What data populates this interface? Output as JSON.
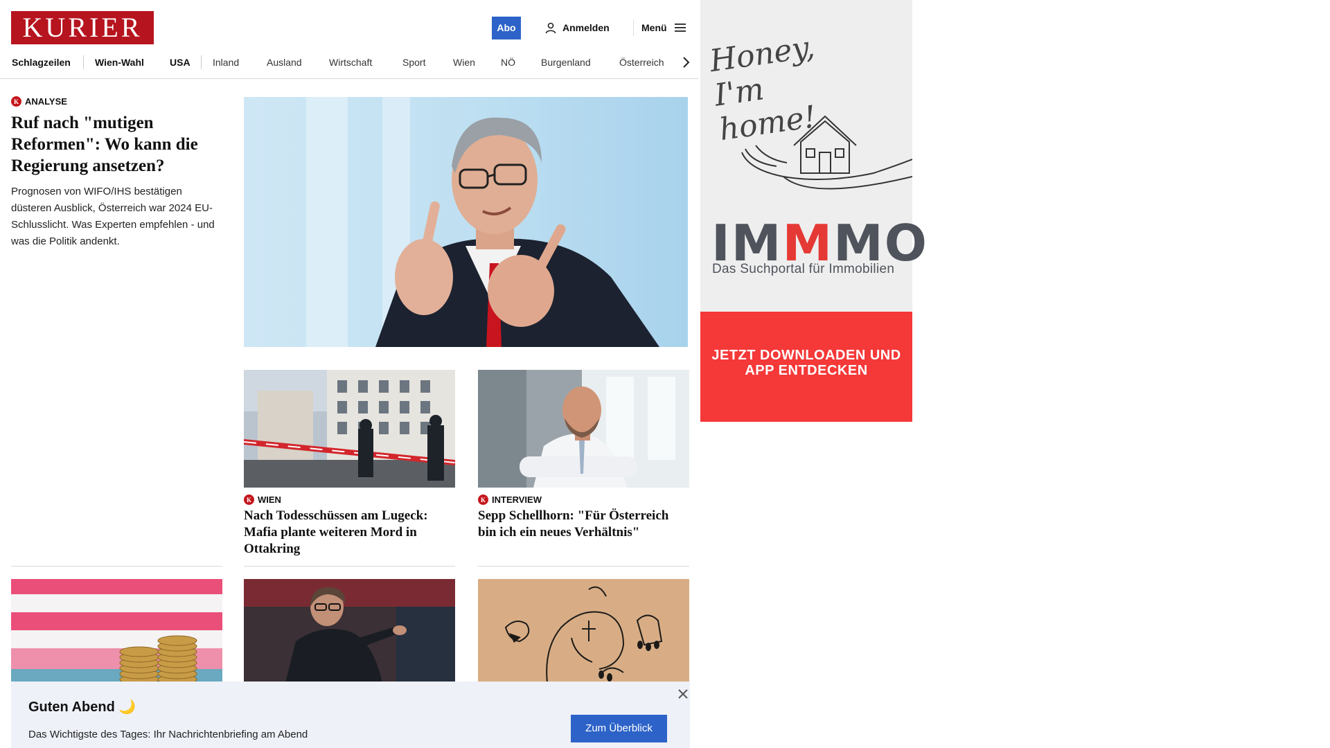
{
  "header": {
    "logo": "KURIER",
    "abo_label": "Abo",
    "login_label": "Anmelden",
    "menu_label": "Menü"
  },
  "nav": {
    "items": [
      "Schlagzeilen",
      "Wien-Wahl",
      "USA",
      "Inland",
      "Ausland",
      "Wirtschaft",
      "Sport",
      "Wien",
      "NÖ",
      "Burgenland",
      "Österreich"
    ]
  },
  "lead": {
    "kicker": "ANALYSE",
    "title": "Ruf nach \"mutigen Reformen\": Wo kann die Regierung ansetzen?",
    "description": "Prognosen von WIFO/IHS bestätigen düsteren Ausblick, Österreich war 2024 EU-Schlusslicht. Was Experten empfehlen - und was die Politik andenkt."
  },
  "cards": [
    {
      "kicker": "WIEN",
      "title": "Nach Todesschüssen am Lugeck: Mafia plante weiteren Mord in Ottakring"
    },
    {
      "kicker": "INTERVIEW",
      "title": "Sepp Schellhorn: \"Für Österreich bin ich ein neues Verhältnis\""
    }
  ],
  "banner": {
    "title": "Guten Abend 🌙",
    "subtitle": "Das Wichtigste des Tages: Ihr Nachrichtenbriefing am Abend",
    "button_label": "Zum Überblick"
  },
  "ad": {
    "script_text": "Honey, I'm home!",
    "brand_part1": "IM",
    "brand_part2": "M",
    "brand_part3": "MO",
    "tagline": "Das Suchportal für Immobilien",
    "cta": "JETZT DOWNLOADEN UND APP ENTDECKEN"
  },
  "colors": {
    "brand_red": "#b6141f",
    "button_blue": "#2d63c8",
    "ad_red": "#f53838"
  }
}
